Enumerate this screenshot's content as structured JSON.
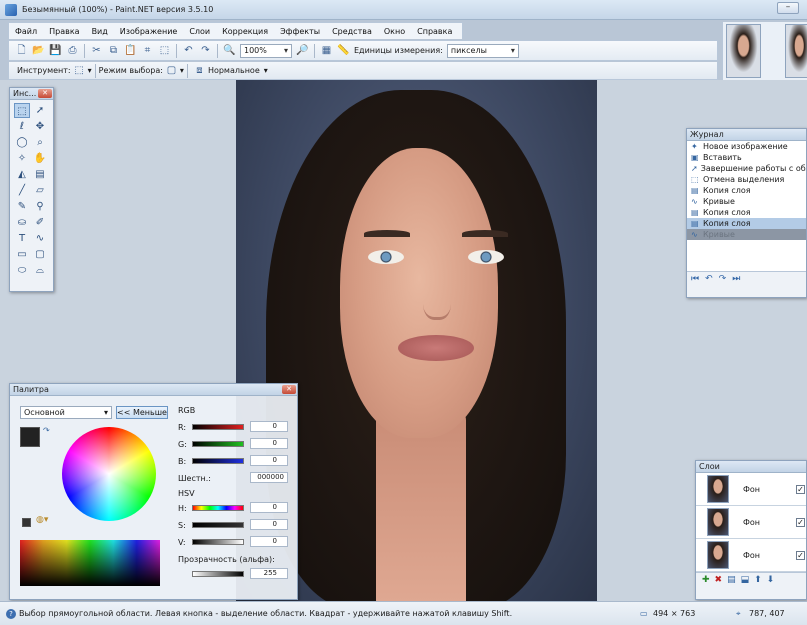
{
  "window": {
    "title": "Безымянный (100%) - Paint.NET версия 3.5.10",
    "min_label": "–"
  },
  "menu": [
    "Файл",
    "Правка",
    "Вид",
    "Изображение",
    "Слои",
    "Коррекция",
    "Эффекты",
    "Средства",
    "Окно",
    "Справка"
  ],
  "toolbar": {
    "zoom": "100%",
    "units_label": "Единицы измерения:",
    "units_value": "пикселы"
  },
  "toolbar2": {
    "tool_label": "Инструмент:",
    "mode_label": "Режим выбора:",
    "blend_value": "Нормальное"
  },
  "tools_window": {
    "title": "Инс..."
  },
  "history": {
    "title": "Журнал",
    "items": [
      {
        "label": "Новое изображение",
        "icon": "new-image-icon"
      },
      {
        "label": "Вставить",
        "icon": "paste-icon"
      },
      {
        "label": "Завершение работы с обл",
        "icon": "finish-selection-icon"
      },
      {
        "label": "Отмена выделения",
        "icon": "deselect-icon"
      },
      {
        "label": "Копия слоя",
        "icon": "duplicate-layer-icon"
      },
      {
        "label": "Кривые",
        "icon": "curves-icon"
      },
      {
        "label": "Копия слоя",
        "icon": "duplicate-layer-icon"
      },
      {
        "label": "Копия слоя",
        "icon": "duplicate-layer-icon",
        "state": "selected"
      },
      {
        "label": "Кривые",
        "icon": "curves-icon",
        "state": "undone"
      }
    ]
  },
  "palette": {
    "title": "Палитра",
    "mode": "Основной",
    "less_button": "<< Меньше",
    "rgb_label": "RGB",
    "r_label": "R:",
    "g_label": "G:",
    "b_label": "B:",
    "r": "0",
    "g": "0",
    "b": "0",
    "hex_label": "Шестн.:",
    "hex": "000000",
    "hsv_label": "HSV",
    "h_label": "H:",
    "s_label": "S:",
    "v_label": "V:",
    "h": "0",
    "s": "0",
    "v": "0",
    "alpha_label": "Прозрачность (альфа):",
    "alpha": "255"
  },
  "layers": {
    "title": "Слои",
    "items": [
      {
        "name": "Фон",
        "checked": true
      },
      {
        "name": "Фон",
        "checked": true
      },
      {
        "name": "Фон",
        "checked": true
      }
    ]
  },
  "status": {
    "hint": "Выбор прямоугольной области. Левая кнопка - выделение области. Квадрат - удерживайте нажатой клавишу Shift.",
    "size": "494 × 763",
    "pos": "787, 407"
  }
}
